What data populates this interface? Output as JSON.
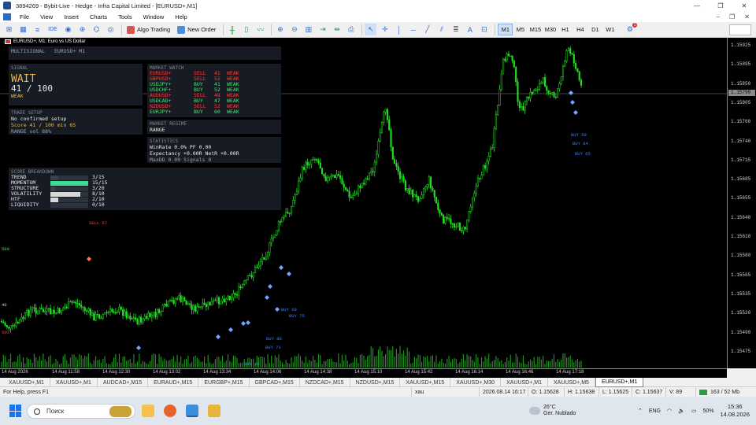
{
  "window": {
    "title": "3894269 - Bybit-Live - Hedge - Infra Capital Limited - [EURUSD+,M1]"
  },
  "menu": [
    "File",
    "View",
    "Insert",
    "Charts",
    "Tools",
    "Window",
    "Help"
  ],
  "toolbar": {
    "algo_trading": "Algo Trading",
    "new_order": "New Order",
    "timeframes": [
      "M1",
      "M5",
      "M15",
      "M30",
      "H1",
      "H4",
      "D1",
      "W1"
    ],
    "active_timeframe": "M1",
    "notification_count": "1"
  },
  "chart_header": {
    "symbol": "EURUSD+, M1:  Euro vs US Dollar"
  },
  "panels": {
    "multisignal": {
      "label": "MULTISIGNAL",
      "symbol": "EURUSD+ M1"
    },
    "signal": {
      "header": "SIGNAL",
      "state": "WAIT",
      "score": "41 / 100",
      "strength": "WEAK"
    },
    "trade_setup": {
      "header": "TRADE SETUP",
      "line1": "No confirmed setup",
      "line2": "Score 41 / 100   min 65",
      "line3": "RANGE   vol 88%"
    },
    "market_watch": {
      "header": "MARKET WATCH",
      "rows": [
        {
          "symbol": "EURUSD+",
          "side": "SELL",
          "score": "41",
          "strength": "WEAK",
          "color": "#ff3b3b"
        },
        {
          "symbol": "GBPUSD+",
          "side": "SELL",
          "score": "52",
          "strength": "WEAK",
          "color": "#ff3b3b"
        },
        {
          "symbol": "USDJPY+",
          "side": "BUY",
          "score": "41",
          "strength": "WEAK",
          "color": "#4ce07a"
        },
        {
          "symbol": "USDCHF+",
          "side": "BUY",
          "score": "52",
          "strength": "WEAK",
          "color": "#4ce07a"
        },
        {
          "symbol": "AUDUSD+",
          "side": "SELL",
          "score": "48",
          "strength": "WEAK",
          "color": "#ff3b3b"
        },
        {
          "symbol": "USDCAD+",
          "side": "BUY",
          "score": "47",
          "strength": "WEAK",
          "color": "#4ce07a"
        },
        {
          "symbol": "NZDUSD+",
          "side": "SELL",
          "score": "52",
          "strength": "WEAK",
          "color": "#ff3b3b"
        },
        {
          "symbol": "EURJPY+",
          "side": "BUY",
          "score": "60",
          "strength": "WEAK",
          "color": "#4ce07a"
        }
      ]
    },
    "market_regime": {
      "header": "MARKET REGIME",
      "value": "RANGE"
    },
    "statistics": {
      "header": "STATISTICS",
      "line1": "WinRate 0.0%   PF 0.00",
      "line2": "Expectancy +0.00R   NetR +0.00R",
      "line3": "MaxDD 0.00   Signals 0"
    },
    "score_breakdown": {
      "header": "SCORE BREAKDOWN",
      "rows": [
        {
          "label": "TREND",
          "value": "3/15",
          "fraction": 0.2,
          "color": "#3a404a"
        },
        {
          "label": "MOMENTUM",
          "value": "15/15",
          "fraction": 1.0,
          "color": "#3ddc97"
        },
        {
          "label": "STRUCTURE",
          "value": "3/20",
          "fraction": 0.15,
          "color": "#3a404a"
        },
        {
          "label": "VOLATILITY",
          "value": "8/10",
          "fraction": 0.8,
          "color": "#d8d8d8"
        },
        {
          "label": "HTF",
          "value": "2/10",
          "fraction": 0.2,
          "color": "#d8d8d8"
        },
        {
          "label": "LIQUIDITY",
          "value": "0/10",
          "fraction": 0.0,
          "color": "#d8d8d8"
        }
      ]
    }
  },
  "chart_labels": {
    "sell67": "SELL 67",
    "buy69_a": "BUY 69",
    "buy75": "BUY 75",
    "buy88": "BUY 88",
    "buy71": "BUY 71",
    "buy69_b": "BUY 69",
    "buy84": "BUY 84",
    "buy65": "BUY 65",
    "left_500": "500",
    "left_40": "40",
    "left_50": "50%",
    "bottom_label": "BUY 66"
  },
  "price_axis": {
    "ticks": [
      "1.15925",
      "1.15895",
      "1.15850",
      "1.15805",
      "1.15760",
      "1.15740",
      "1.15715",
      "1.15685",
      "1.15655",
      "1.15640",
      "1.15610",
      "1.15580",
      "1.15565",
      "1.15535",
      "1.15520",
      "1.15490",
      "1.15475"
    ],
    "current": "1.15790"
  },
  "time_axis": {
    "ticks": [
      "14 Aug 2026",
      "14 Aug 11:58",
      "14 Aug 12:30",
      "14 Aug 13:02",
      "14 Aug 13:34",
      "14 Aug 14:06",
      "14 Aug 14:38",
      "14 Aug 15:10",
      "14 Aug 15:42",
      "14 Aug 16:14",
      "14 Aug 16:46",
      "14 Aug 17:18"
    ]
  },
  "tabs": [
    "XAUUSD+,M1",
    "XAUUSD+,M1",
    "AUDCAD+,M15",
    "EURAUD+,M15",
    "EURGBP+,M15",
    "GBPCAD+,M15",
    "NZDCAD+,M15",
    "NZDUSD+,M15",
    "XAUUSD+,M15",
    "XAUUSD+,M30",
    "XAUUSD+,M1",
    "XAUUSD+,M5",
    "EURUSD+,M1"
  ],
  "active_tab": 12,
  "status": {
    "help": "For Help, press F1",
    "profile": "xau",
    "datetime": "2026.08.14 16:17",
    "open": "O: 1.15628",
    "high": "H: 1.15638",
    "low": "L: 1.15625",
    "close": "C: 1.15637",
    "volume": "V: 89",
    "traffic": "163 / 52 Mb"
  },
  "taskbar": {
    "search_placeholder": "Поиск",
    "weather_temp": "26°C",
    "weather_desc": "Ger. Nublado",
    "lang": "ENG",
    "battery": "50%",
    "time": "15:36",
    "date": "14.08.2026"
  }
}
